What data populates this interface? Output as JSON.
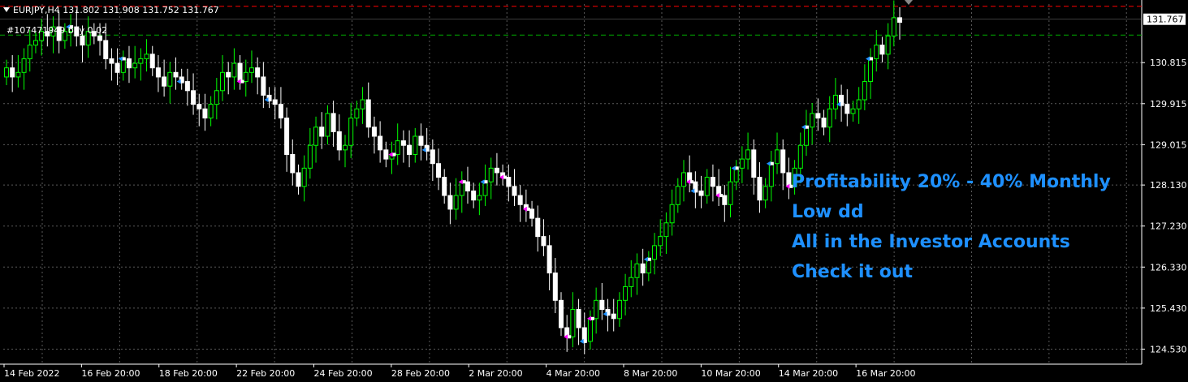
{
  "header": {
    "symbol_line": "EURJPY,H4  131.802 131.908 131.752 131.767"
  },
  "trade_label": "#107471949 buy 0.02",
  "promo_lines": [
    "Profitability 20% - 40% Monthly",
    "Low dd",
    "All in the Investor Accounts",
    "Check it out"
  ],
  "colors": {
    "background": "#000000",
    "grid": "#5a5a5a",
    "bull_candle": "#00ff00",
    "bear_candle": "#ffffff",
    "ask_line": "#ff0000",
    "trade_line": "#00aa00",
    "promo_text": "#1e90ff",
    "price_tag_bg": "#ffffff"
  },
  "chart_data": {
    "type": "candlestick",
    "symbol": "EURJPY",
    "timeframe": "H4",
    "current_price": 131.767,
    "ylim": [
      124.2,
      132.1
    ],
    "y_ticks": [
      "131.767",
      "130.815",
      "129.915",
      "129.015",
      "128.130",
      "127.230",
      "126.330",
      "125.430",
      "124.530"
    ],
    "x_ticks": [
      "14 Feb 2022",
      "16 Feb 20:00",
      "18 Feb 20:00",
      "22 Feb 20:00",
      "24 Feb 20:00",
      "28 Feb 20:00",
      "2 Mar 20:00",
      "4 Mar 20:00",
      "8 Mar 20:00",
      "10 Mar 20:00",
      "14 Mar 20:00",
      "16 Mar 20:00"
    ],
    "closes": [
      130.7,
      130.5,
      130.6,
      130.9,
      131.2,
      131.3,
      131.5,
      131.4,
      131.6,
      131.3,
      131.5,
      131.6,
      131.4,
      131.2,
      131.5,
      131.4,
      131.3,
      130.9,
      130.8,
      130.6,
      130.9,
      130.7,
      130.8,
      130.9,
      131.0,
      130.7,
      130.5,
      130.3,
      130.6,
      130.5,
      130.4,
      130.2,
      129.9,
      129.8,
      129.6,
      129.9,
      130.2,
      130.6,
      130.5,
      130.8,
      130.4,
      130.6,
      130.7,
      130.5,
      130.1,
      130.0,
      129.9,
      129.6,
      128.8,
      128.4,
      128.1,
      128.5,
      129.0,
      129.4,
      129.2,
      129.7,
      129.3,
      128.9,
      129.0,
      129.6,
      129.8,
      130.0,
      129.4,
      129.2,
      128.9,
      128.7,
      128.8,
      129.1,
      129.0,
      128.8,
      129.2,
      129.0,
      128.9,
      128.6,
      128.3,
      127.9,
      127.6,
      127.9,
      128.2,
      128.0,
      127.8,
      127.9,
      128.2,
      128.5,
      128.4,
      128.3,
      128.1,
      127.9,
      127.7,
      127.6,
      127.4,
      127.0,
      126.8,
      126.2,
      125.6,
      125.0,
      124.8,
      125.4,
      125.0,
      124.7,
      125.2,
      125.6,
      125.4,
      125.3,
      125.2,
      125.6,
      125.9,
      126.1,
      126.4,
      126.2,
      126.5,
      126.8,
      127.0,
      127.3,
      127.7,
      128.1,
      128.4,
      128.2,
      128.0,
      127.9,
      128.3,
      128.1,
      127.9,
      127.7,
      128.2,
      128.5,
      128.7,
      128.9,
      128.3,
      127.8,
      128.1,
      128.6,
      128.9,
      128.4,
      128.1,
      128.5,
      129.0,
      129.4,
      129.7,
      129.6,
      129.4,
      129.8,
      130.1,
      129.9,
      129.7,
      129.8,
      130.0,
      130.4,
      130.9,
      131.2,
      131.0,
      131.4,
      131.8,
      131.7
    ],
    "buy_markers": [
      11,
      20,
      30,
      45,
      72,
      82,
      99,
      103,
      110,
      118,
      125,
      131,
      137,
      143,
      148,
      154,
      157
    ],
    "sell_markers": [
      40,
      66,
      78,
      85,
      89,
      96,
      100,
      117,
      122,
      134
    ]
  }
}
